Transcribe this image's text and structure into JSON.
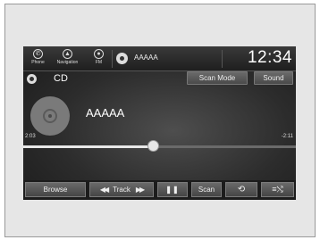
{
  "topbar": {
    "phone_label": "Phone",
    "navigation_label": "Navigation",
    "fm_label": "FM",
    "source_text": "AAAAA",
    "clock": "12:34"
  },
  "header": {
    "source_title": "CD",
    "scan_mode_label": "Scan Mode",
    "sound_label": "Sound"
  },
  "now_playing": {
    "title": "AAAAA",
    "elapsed": "2:03",
    "remaining": "-2:11",
    "progress_fraction": 0.48
  },
  "controls": {
    "browse_label": "Browse",
    "track_label": "Track",
    "prev_icon": "skip-back-icon",
    "next_icon": "skip-forward-icon",
    "pause_icon": "pause-icon",
    "scan_label": "Scan",
    "repeat_icon": "repeat-icon",
    "shuffle_icon": "shuffle-icon"
  },
  "colors": {
    "screen_bg": "#2c2c2c",
    "button_bg": "#555555",
    "text": "#ffffff"
  }
}
